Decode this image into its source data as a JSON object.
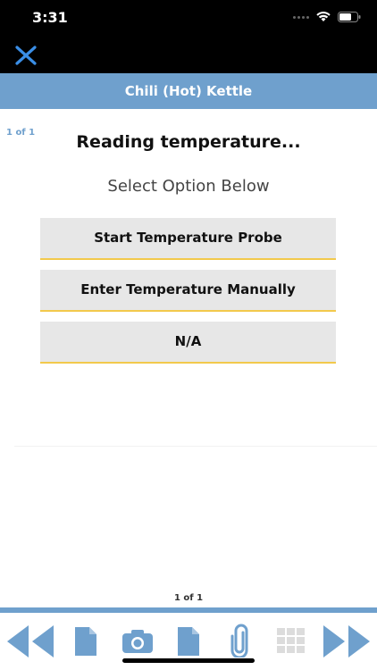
{
  "status": {
    "time": "3:31"
  },
  "header": {
    "title": "Chili (Hot) Kettle"
  },
  "page": {
    "top_indicator": "1 of 1",
    "heading": "Reading temperature...",
    "subheading": "Select Option Below",
    "bottom_indicator": "1 of 1"
  },
  "options": [
    {
      "label": "Start Temperature Probe"
    },
    {
      "label": "Enter Temperature Manually"
    },
    {
      "label": "N/A"
    }
  ],
  "colors": {
    "accent": "#6fa0cd",
    "close": "#3a8ee6",
    "option_bg": "#e7e7e7",
    "option_underline": "#f2c94c"
  },
  "toolbar": {
    "icons": [
      "previous-icon",
      "document-icon",
      "camera-icon",
      "document-icon",
      "paperclip-icon",
      "grid-icon",
      "next-icon"
    ]
  }
}
